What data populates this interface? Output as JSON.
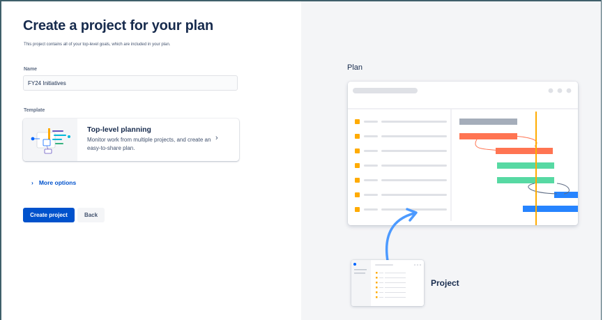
{
  "form": {
    "title": "Create a project for your plan",
    "subtitle": "This project contains all of your top-level goals, which are included in your plan.",
    "name_label": "Name",
    "name_value": "FY24 Initiatives",
    "template_label": "Template",
    "template": {
      "title": "Top-level planning",
      "description": "Monitor work from multiple projects, and create an easy-to-share plan.",
      "chevron_icon": "chevron-right-icon"
    },
    "more_options": "More options",
    "create_button": "Create project",
    "back_button": "Back"
  },
  "illustration": {
    "plan_label": "Plan",
    "project_label": "Project",
    "colors": {
      "gray_bar": "#a5adba",
      "red_bar": "#ff7452",
      "green_bar": "#57d9a3",
      "blue_bar": "#2684ff",
      "marker": "#ffab00",
      "today_line": "#ffab00",
      "arrow": "#4c9aff"
    }
  }
}
